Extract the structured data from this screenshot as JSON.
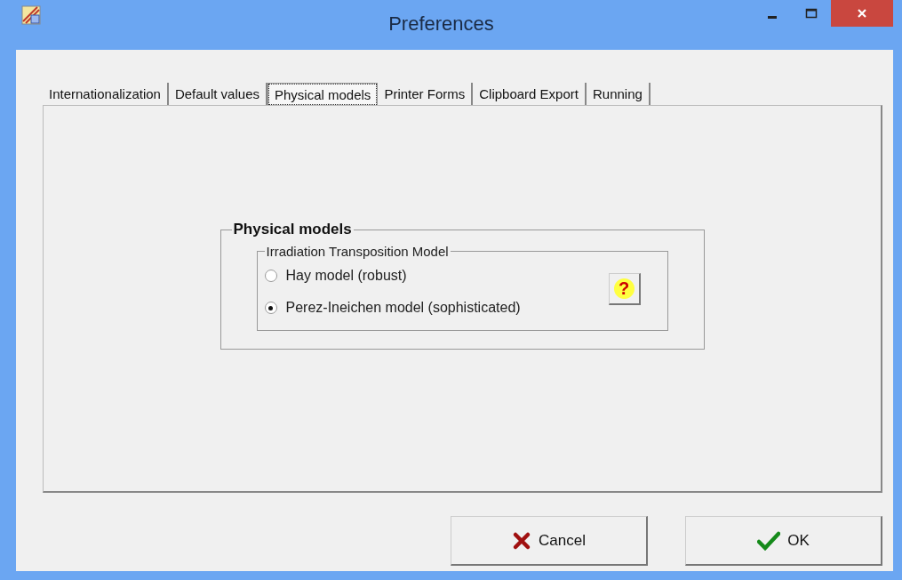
{
  "window": {
    "title": "Preferences"
  },
  "tabs": [
    {
      "label": "Internationalization",
      "selected": false
    },
    {
      "label": "Default values",
      "selected": false
    },
    {
      "label": "Physical models",
      "selected": true
    },
    {
      "label": "Printer Forms",
      "selected": false
    },
    {
      "label": "Clipboard Export",
      "selected": false
    },
    {
      "label": "Running",
      "selected": false
    }
  ],
  "group": {
    "title": "Physical models",
    "subgroup": {
      "title": "Irradiation Transposition Model",
      "options": [
        {
          "label": "Hay model (robust)",
          "selected": false
        },
        {
          "label": "Perez-Ineichen model (sophisticated)",
          "selected": true
        }
      ],
      "help_button": "?"
    }
  },
  "buttons": [
    {
      "kind": "cancel",
      "label": "Cancel"
    },
    {
      "kind": "ok",
      "label": "OK"
    }
  ]
}
